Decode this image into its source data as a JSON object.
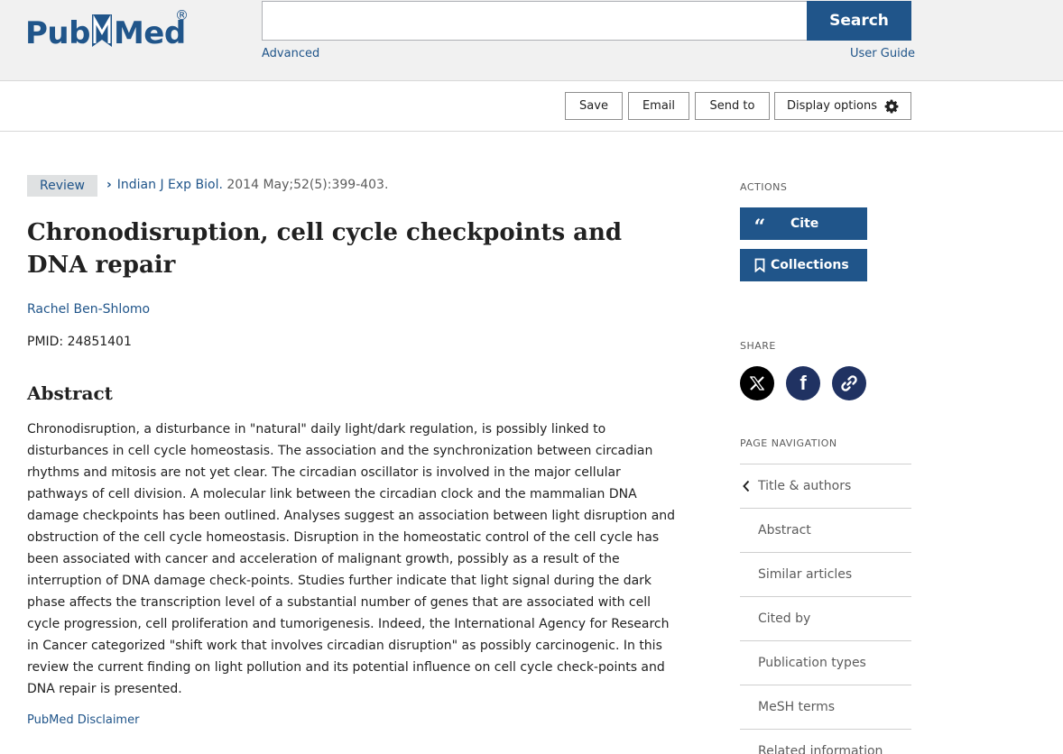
{
  "header": {
    "logo_text_1": "Pub",
    "logo_text_2": "Med",
    "logo_reg": "®",
    "search_value": "",
    "search_label": "Search",
    "advanced_label": "Advanced",
    "user_guide_label": "User Guide"
  },
  "toolbar": {
    "save_label": "Save",
    "email_label": "Email",
    "send_to_label": "Send to",
    "display_options_label": "Display options"
  },
  "article": {
    "type_badge": "Review",
    "journal": "Indian J Exp Biol.",
    "citation": " 2014 May;52(5):399-403.",
    "title": "Chronodisruption, cell cycle checkpoints and DNA repair",
    "author": "Rachel Ben-Shlomo",
    "pmid_label": "PMID: ",
    "pmid_value": "24851401",
    "abstract_heading": "Abstract",
    "abstract_text": "Chronodisruption, a disturbance in \"natural\" daily light/dark regulation, is possibly linked to disturbances in cell cycle homeostasis. The association and the synchronization between circadian rhythms and mitosis are not yet clear. The circadian oscillator is involved in the major cellular pathways of cell division. A molecular link between the circadian clock and the mammalian DNA damage checkpoints has been outlined. Analyses suggest an association between light disruption and obstruction of the cell cycle homeostasis. Disruption in the homeostatic control of the cell cycle has been associated with cancer and acceleration of malignant growth, possibly as a result of the interruption of DNA damage check-points. Studies further indicate that light signal during the dark phase affects the transcription level of a substantial number of genes that are associated with cell cycle progression, cell proliferation and tumorigenesis. Indeed, the International Agency for Research in Cancer categorized \"shift work that involves circadian disruption\" as possibly carcinogenic. In this review the current finding on light pollution and its potential influence on cell cycle check-points and DNA repair is presented.",
    "disclaimer": "PubMed Disclaimer"
  },
  "sidebar": {
    "actions_heading": "ACTIONS",
    "cite_label": "Cite",
    "collections_label": "Collections",
    "share_heading": "SHARE",
    "share_icons": [
      "x-icon",
      "facebook-icon",
      "link-icon"
    ],
    "page_nav_heading": "PAGE NAVIGATION",
    "nav_items": [
      {
        "label": "Title & authors"
      },
      {
        "label": "Abstract"
      },
      {
        "label": "Similar articles"
      },
      {
        "label": "Cited by"
      },
      {
        "label": "Publication types"
      },
      {
        "label": "MeSH terms"
      },
      {
        "label": "Related information"
      }
    ]
  },
  "colors": {
    "brand_blue": "#20558a",
    "share_navy": "#203262",
    "header_bg": "#f1f1f1"
  }
}
